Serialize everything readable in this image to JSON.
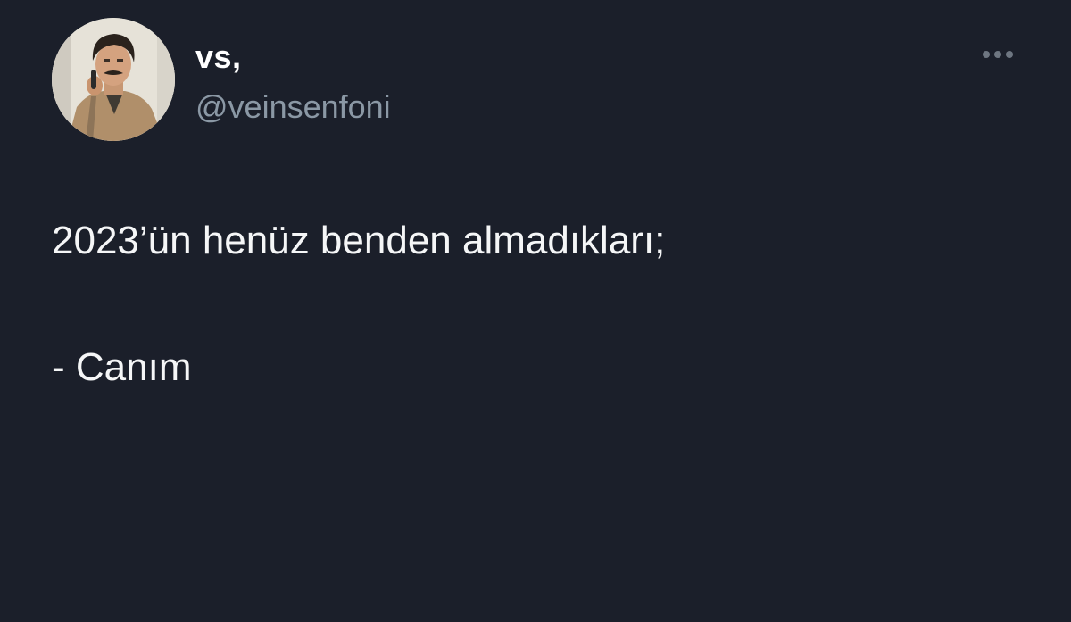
{
  "author": {
    "display_name": "vs,",
    "handle": "@veinsenfoni",
    "avatar_icon": "profile-photo"
  },
  "menu": {
    "icon": "more-horizontal-icon"
  },
  "tweet": {
    "lines": [
      "2023’ün henüz benden almadıkları;",
      "- Canım"
    ]
  },
  "colors": {
    "background": "#1b1f2a",
    "primary_text": "#ffffff",
    "secondary_text": "#8b98a5",
    "icon": "#6e7681"
  }
}
